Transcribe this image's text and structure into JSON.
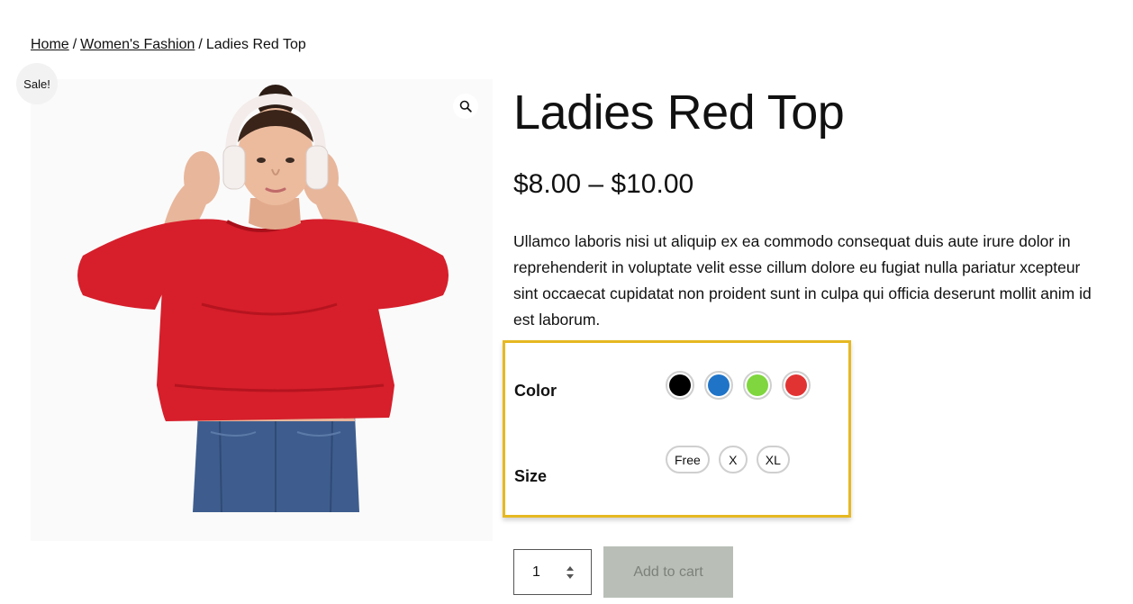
{
  "breadcrumb": {
    "home": "Home",
    "category": "Women's Fashion",
    "separator": "/",
    "current": "Ladies Red Top"
  },
  "gallery": {
    "sale_badge": "Sale!",
    "zoom_icon": "magnifier-icon",
    "image_subject": "woman-in-red-top-with-headphones"
  },
  "product": {
    "title": "Ladies Red Top",
    "price": "$8.00 – $10.00",
    "description": "Ullamco laboris nisi ut aliquip ex ea commodo consequat duis aute irure dolor in reprehenderit in voluptate velit esse cillum dolore eu fugiat nulla pariatur xcepteur sint occaecat cupidatat non proident sunt in culpa qui officia deserunt mollit anim id est laborum."
  },
  "variations": {
    "highlight_color": "#e6b822",
    "color_label": "Color",
    "colors": [
      {
        "name": "black",
        "hex": "#000000"
      },
      {
        "name": "blue",
        "hex": "#1f74c8"
      },
      {
        "name": "green",
        "hex": "#7fd63e"
      },
      {
        "name": "red",
        "hex": "#e23333"
      }
    ],
    "size_label": "Size",
    "sizes": [
      "Free",
      "X",
      "XL"
    ]
  },
  "cart": {
    "quantity": "1",
    "add_to_cart_label": "Add to cart",
    "button_color": "#b9bfb7"
  }
}
